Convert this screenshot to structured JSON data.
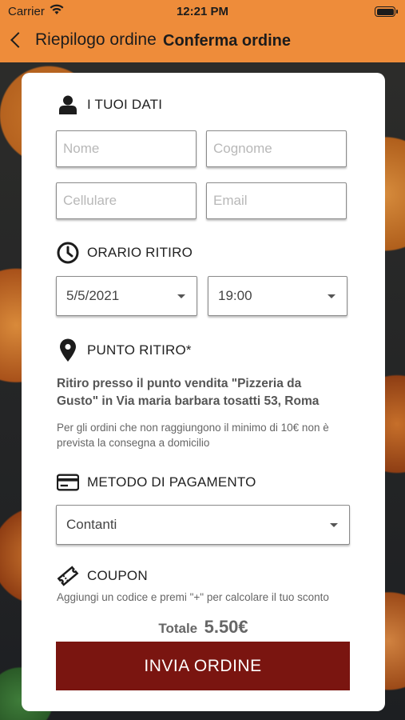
{
  "status_bar": {
    "carrier": "Carrier",
    "time": "12:21 PM",
    "wifi_icon": "wifi-icon",
    "battery_icon": "battery-icon"
  },
  "nav": {
    "back_label": "Riepilogo ordine",
    "title": "Conferma ordine",
    "accent_color": "#ee8c3a"
  },
  "personal": {
    "heading": "I TUOI DATI",
    "icon": "user-icon",
    "first_name_placeholder": "Nome",
    "last_name_placeholder": "Cognome",
    "phone_placeholder": "Cellulare",
    "email_placeholder": "Email"
  },
  "pickup_time": {
    "heading": "ORARIO RITIRO",
    "icon": "clock-icon",
    "date": "5/5/2021",
    "time": "19:00"
  },
  "pickup_point": {
    "heading": "PUNTO RITIRO*",
    "icon": "map-pin-icon",
    "address": "Ritiro presso il punto vendita \"Pizzeria da Gusto\" in Via maria barbara tosatti 53, Roma",
    "note": "Per gli ordini che non raggiungono il minimo di 10€ non è prevista la consegna a domicilio"
  },
  "payment": {
    "heading": "METODO DI PAGAMENTO",
    "icon": "credit-card-icon",
    "selected": "Contanti"
  },
  "coupon": {
    "heading": "COUPON",
    "icon": "ticket-icon",
    "note": "Aggiungi un codice e premi \"+\" per calcolare il tuo sconto"
  },
  "total": {
    "label": "Totale",
    "value": "5.50€"
  },
  "submit": {
    "label": "INVIA ORDINE",
    "color": "#7a1510"
  }
}
